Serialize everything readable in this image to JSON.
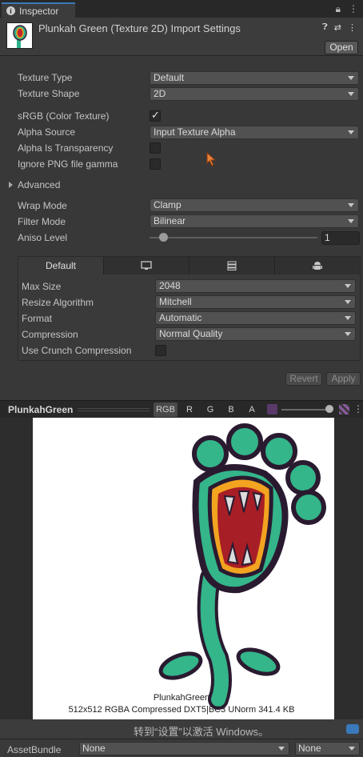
{
  "window": {
    "tab_title": "Inspector"
  },
  "header": {
    "title": "Plunkah Green (Texture 2D) Import Settings",
    "open_label": "Open"
  },
  "settings": {
    "texture_type": {
      "label": "Texture Type",
      "value": "Default"
    },
    "texture_shape": {
      "label": "Texture Shape",
      "value": "2D"
    },
    "srgb": {
      "label": "sRGB (Color Texture)",
      "checked": true
    },
    "alpha_source": {
      "label": "Alpha Source",
      "value": "Input Texture Alpha"
    },
    "alpha_is_transparency": {
      "label": "Alpha Is Transparency",
      "checked": false
    },
    "ignore_png_gamma": {
      "label": "Ignore PNG file gamma",
      "checked": false
    },
    "advanced": {
      "label": "Advanced"
    },
    "wrap_mode": {
      "label": "Wrap Mode",
      "value": "Clamp"
    },
    "filter_mode": {
      "label": "Filter Mode",
      "value": "Bilinear"
    },
    "aniso_level": {
      "label": "Aniso Level",
      "value": "1"
    }
  },
  "platform": {
    "tabs": [
      {
        "label": "Default",
        "icon": ""
      },
      {
        "label": "",
        "icon": "monitor-icon"
      },
      {
        "label": "",
        "icon": "server-icon"
      },
      {
        "label": "",
        "icon": "android-icon"
      }
    ],
    "max_size": {
      "label": "Max Size",
      "value": "2048"
    },
    "resize_algorithm": {
      "label": "Resize Algorithm",
      "value": "Mitchell"
    },
    "format": {
      "label": "Format",
      "value": "Automatic"
    },
    "compression": {
      "label": "Compression",
      "value": "Normal Quality"
    },
    "crunch": {
      "label": "Use Crunch Compression",
      "checked": false
    }
  },
  "actions": {
    "revert": "Revert",
    "apply": "Apply"
  },
  "preview": {
    "title": "PlunkahGreen",
    "channels": [
      "RGB",
      "R",
      "G",
      "B",
      "A"
    ],
    "name": "PlunkahGreen",
    "info": "512x512  RGBA Compressed DXT5|BC3 UNorm   341.4 KB"
  },
  "watermark": {
    "text": "转到“设置”以激活 Windows。"
  },
  "assetbundle": {
    "label": "AssetBundle",
    "name": "None",
    "variant": "None"
  },
  "colors": {
    "accent": "#3a79bb",
    "background": "#383838"
  }
}
